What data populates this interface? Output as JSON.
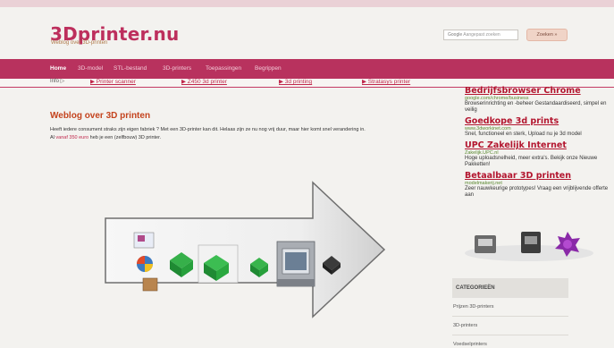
{
  "header": {
    "logo": "3Dprinter.nu",
    "tagline": "Weblog over 3D-printen",
    "search_engine": "Google",
    "search_placeholder": "Aangepast zoeken",
    "search_button": "Zoeken »"
  },
  "nav": {
    "items": [
      "Home",
      "3D-model",
      "STL-bestand",
      "3D-printers",
      "Toepassingen",
      "Begrippen"
    ],
    "active": "Home"
  },
  "links_bar": {
    "info": "Info ▷",
    "links": [
      "▶ Printer scanner",
      "▶ Z450 3d printer",
      "▶ 3d printing",
      "▶ Stratasys printer"
    ]
  },
  "post": {
    "title": "Weblog over 3D printen",
    "line1": "Heeft iedere consument straks zijn eigen fabriek ? Met een 3D-printer kan dit. Helaas zijn ze nu nog vrij duur, maar hier komt snel verandering in.",
    "line2_prefix": "Al ",
    "line2_link": "vanaf 350 euro",
    "line2_suffix": " heb je een (zelfbouw) 3D printer."
  },
  "ads": [
    {
      "title": "Bedrijfsbrowser Chrome",
      "url": "google.com/chrome/business",
      "desc": "Browserinrichting en -beheer Gestandaardiseerd, simpel en veilig"
    },
    {
      "title": "Goedkope 3d prints",
      "url": "www.3dworkinet.com",
      "desc": "Snel, functioneel en sterk, Upload nu je 3d model"
    },
    {
      "title": "UPC Zakelijk Internet",
      "url": "Zakelijk.UPC.nl",
      "desc": "Hoge uploadsnelheid, meer extra's. Bekijk onze Nieuwe Pakketten!"
    },
    {
      "title": "Betaalbaar 3D printen",
      "url": "modelmakerij.net",
      "desc": "Zeer nauwkeurige prototypes! Vraag een vrijblijvende offerte aan"
    }
  ],
  "categories": {
    "title": "CATEGORIEËN",
    "items": [
      "Prijzen 3D-printers",
      "3D-printers",
      "Voedselprinters"
    ]
  },
  "colors": {
    "brand": "#b8325e",
    "link": "#c0284c",
    "post_title": "#c4431d",
    "ad_url": "#5b8a32"
  }
}
